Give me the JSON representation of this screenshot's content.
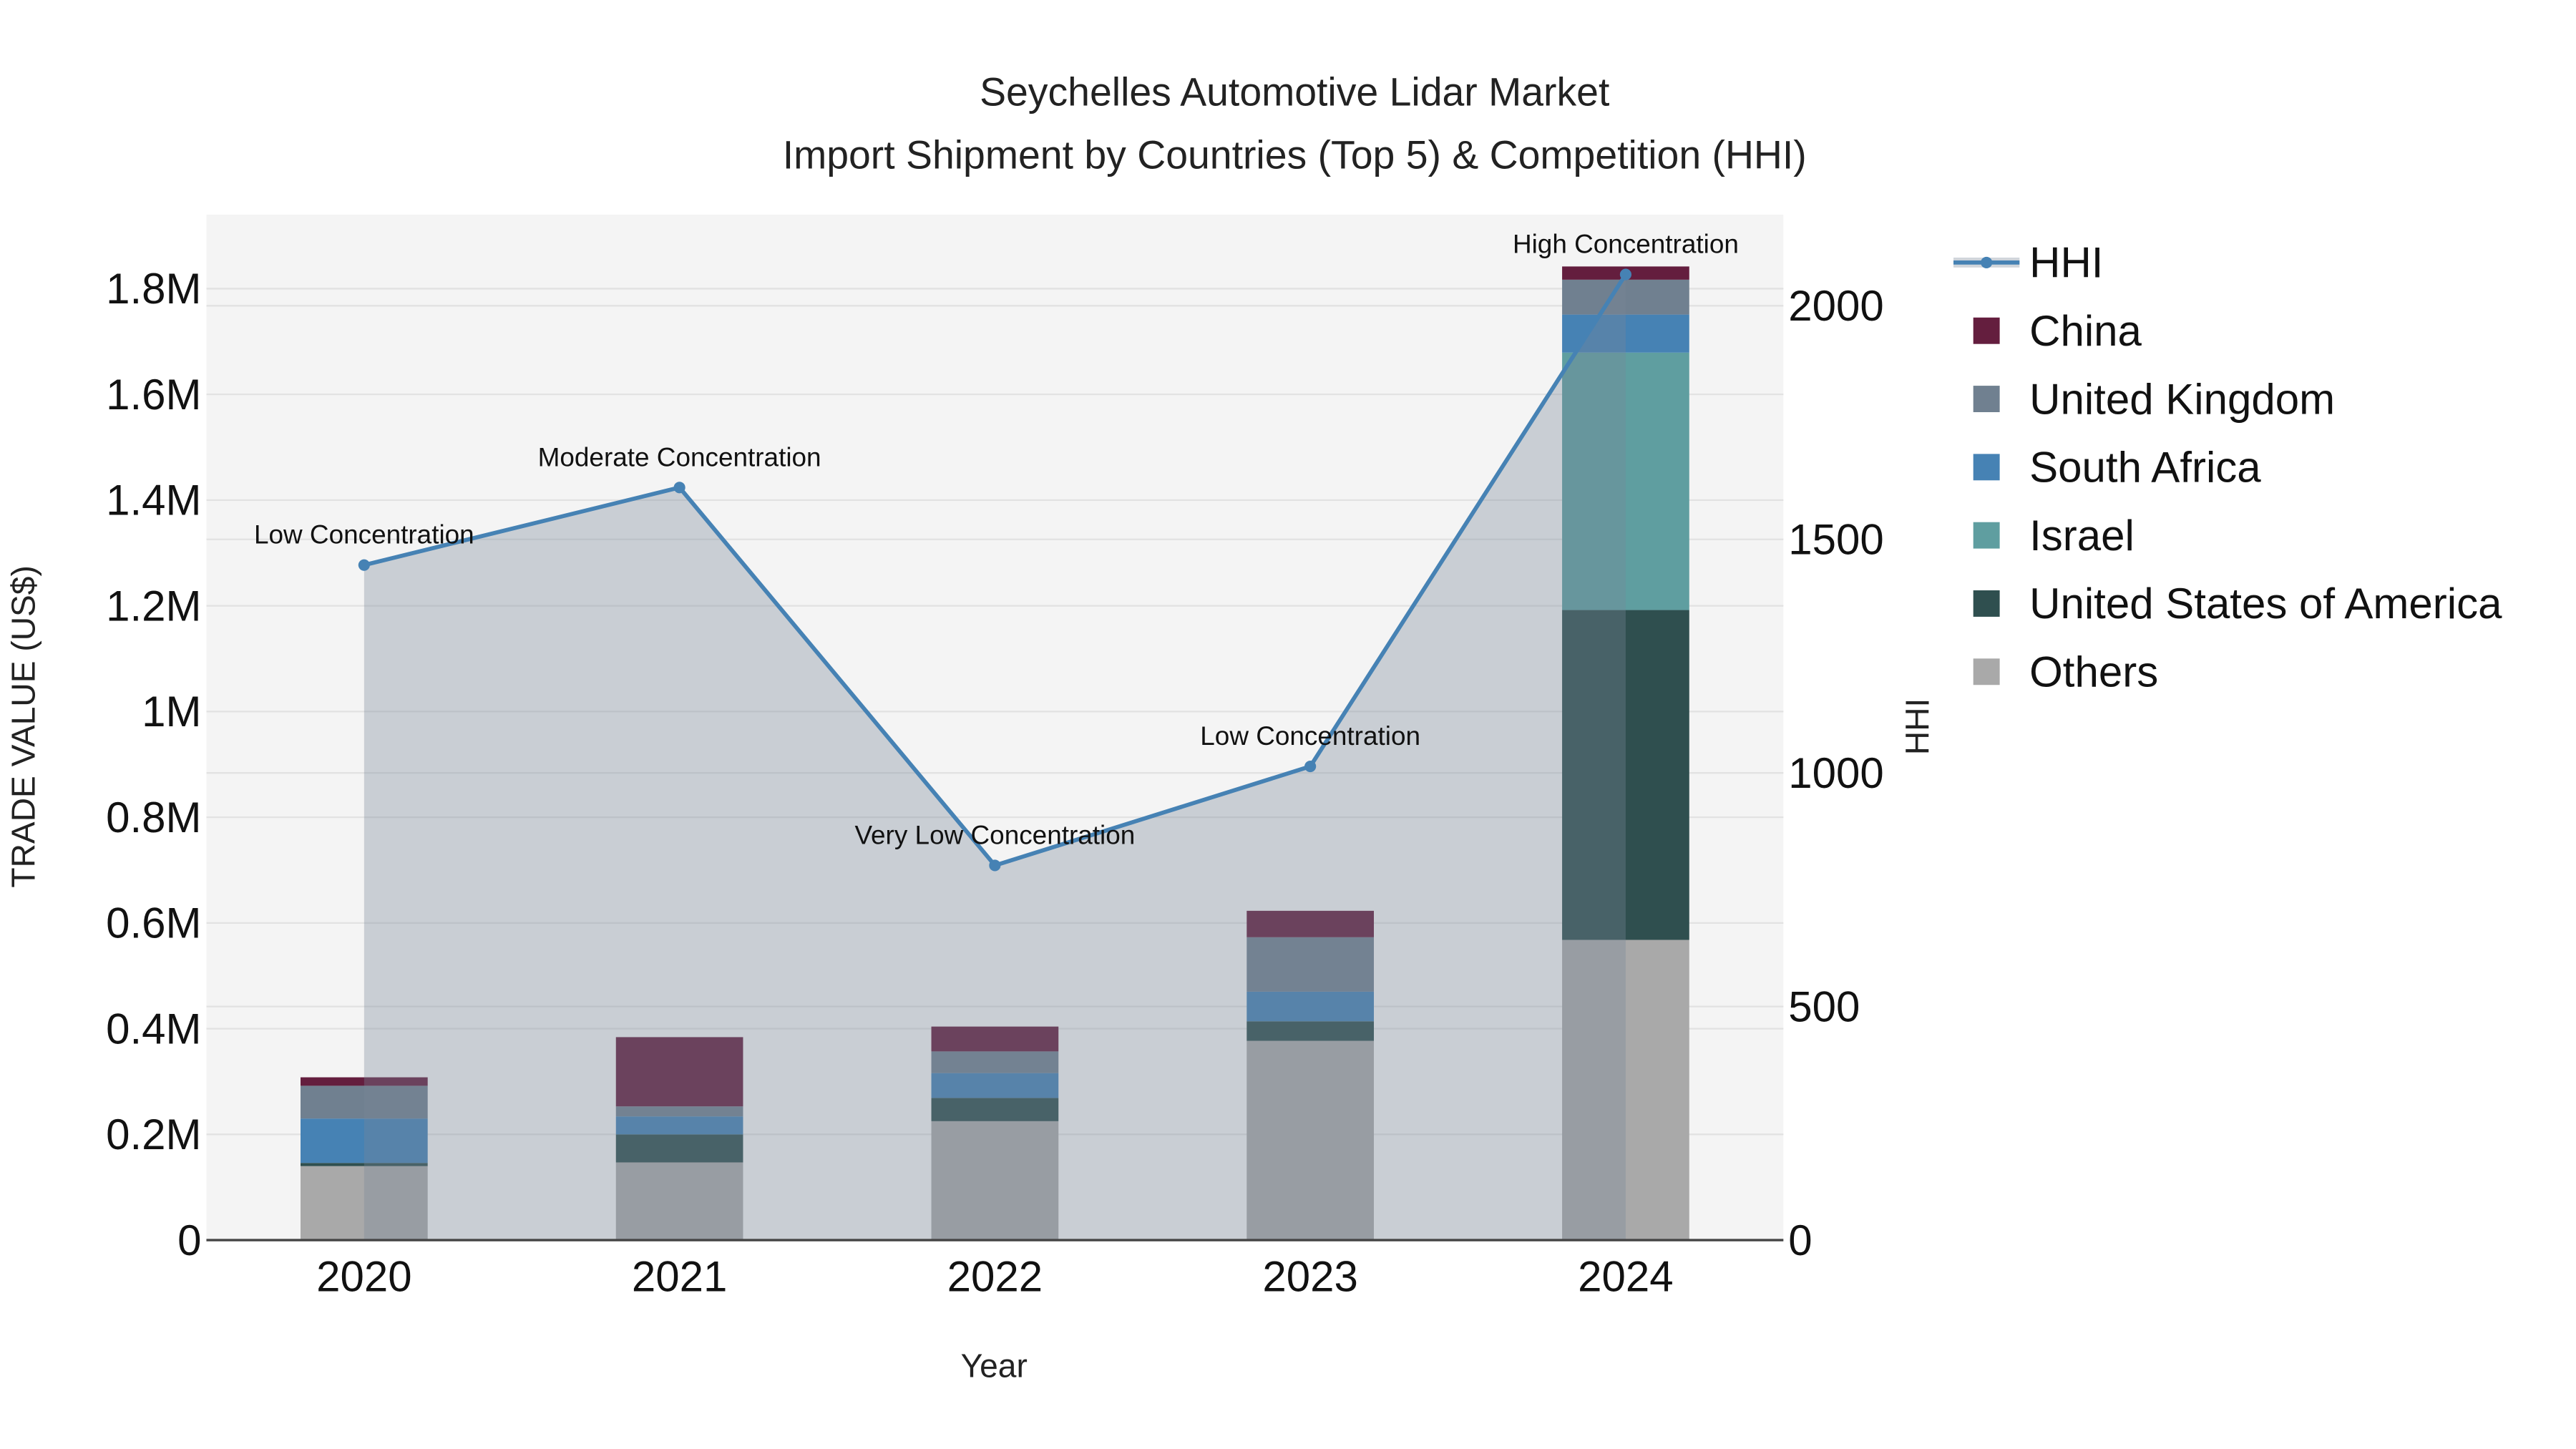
{
  "chart_data": {
    "type": "bar",
    "stacked": true,
    "title": "Seychelles Automotive Lidar Market",
    "subtitle": "Import Shipment by Countries (Top 5) & Competition (HHI)",
    "xlabel": "Year",
    "ylabel": "TRADE VALUE (US$)",
    "y2label": "HHI",
    "categories": [
      "2020",
      "2021",
      "2022",
      "2023",
      "2024"
    ],
    "ylim": [
      0,
      1940000
    ],
    "y2lim": [
      0,
      2195
    ],
    "yticks": [
      0,
      200000,
      400000,
      600000,
      800000,
      1000000,
      1200000,
      1400000,
      1600000,
      1800000
    ],
    "ytick_labels": [
      "0",
      "0.2M",
      "0.4M",
      "0.6M",
      "0.8M",
      "1M",
      "1.2M",
      "1.4M",
      "1.6M",
      "1.8M"
    ],
    "y2ticks": [
      0,
      500,
      1000,
      1500,
      2000
    ],
    "y2tick_labels": [
      "0",
      "500",
      "1000",
      "1500",
      "2000"
    ],
    "series": [
      {
        "name": "Others",
        "color": "#A9A9A9",
        "values": [
          140000,
          147000,
          225000,
          377000,
          568000
        ]
      },
      {
        "name": "United States of America",
        "color": "#2F4F4F",
        "values": [
          6000,
          53000,
          44000,
          37000,
          624000
        ]
      },
      {
        "name": "Israel",
        "color": "#5F9EA0",
        "values": [
          0,
          0,
          0,
          0,
          487000
        ]
      },
      {
        "name": "South Africa",
        "color": "#4682B4",
        "values": [
          84000,
          34000,
          47000,
          56000,
          72000
        ]
      },
      {
        "name": "United Kingdom",
        "color": "#708090",
        "values": [
          62000,
          19000,
          41000,
          103000,
          66000
        ]
      },
      {
        "name": "China",
        "color": "#641E3E",
        "values": [
          16000,
          131000,
          47000,
          50000,
          25000
        ]
      }
    ],
    "line": {
      "name": "HHI",
      "color": "#4682B4",
      "values": [
        1445,
        1611,
        802,
        1014,
        2067
      ],
      "annotations": [
        "Low Concentration",
        "Moderate Concentration",
        "Very Low Concentration",
        "Low Concentration",
        "High Concentration"
      ]
    },
    "legend_order": [
      "HHI",
      "China",
      "United Kingdom",
      "South Africa",
      "Israel",
      "United States of America",
      "Others"
    ],
    "legend_position": "right",
    "grid": true
  }
}
